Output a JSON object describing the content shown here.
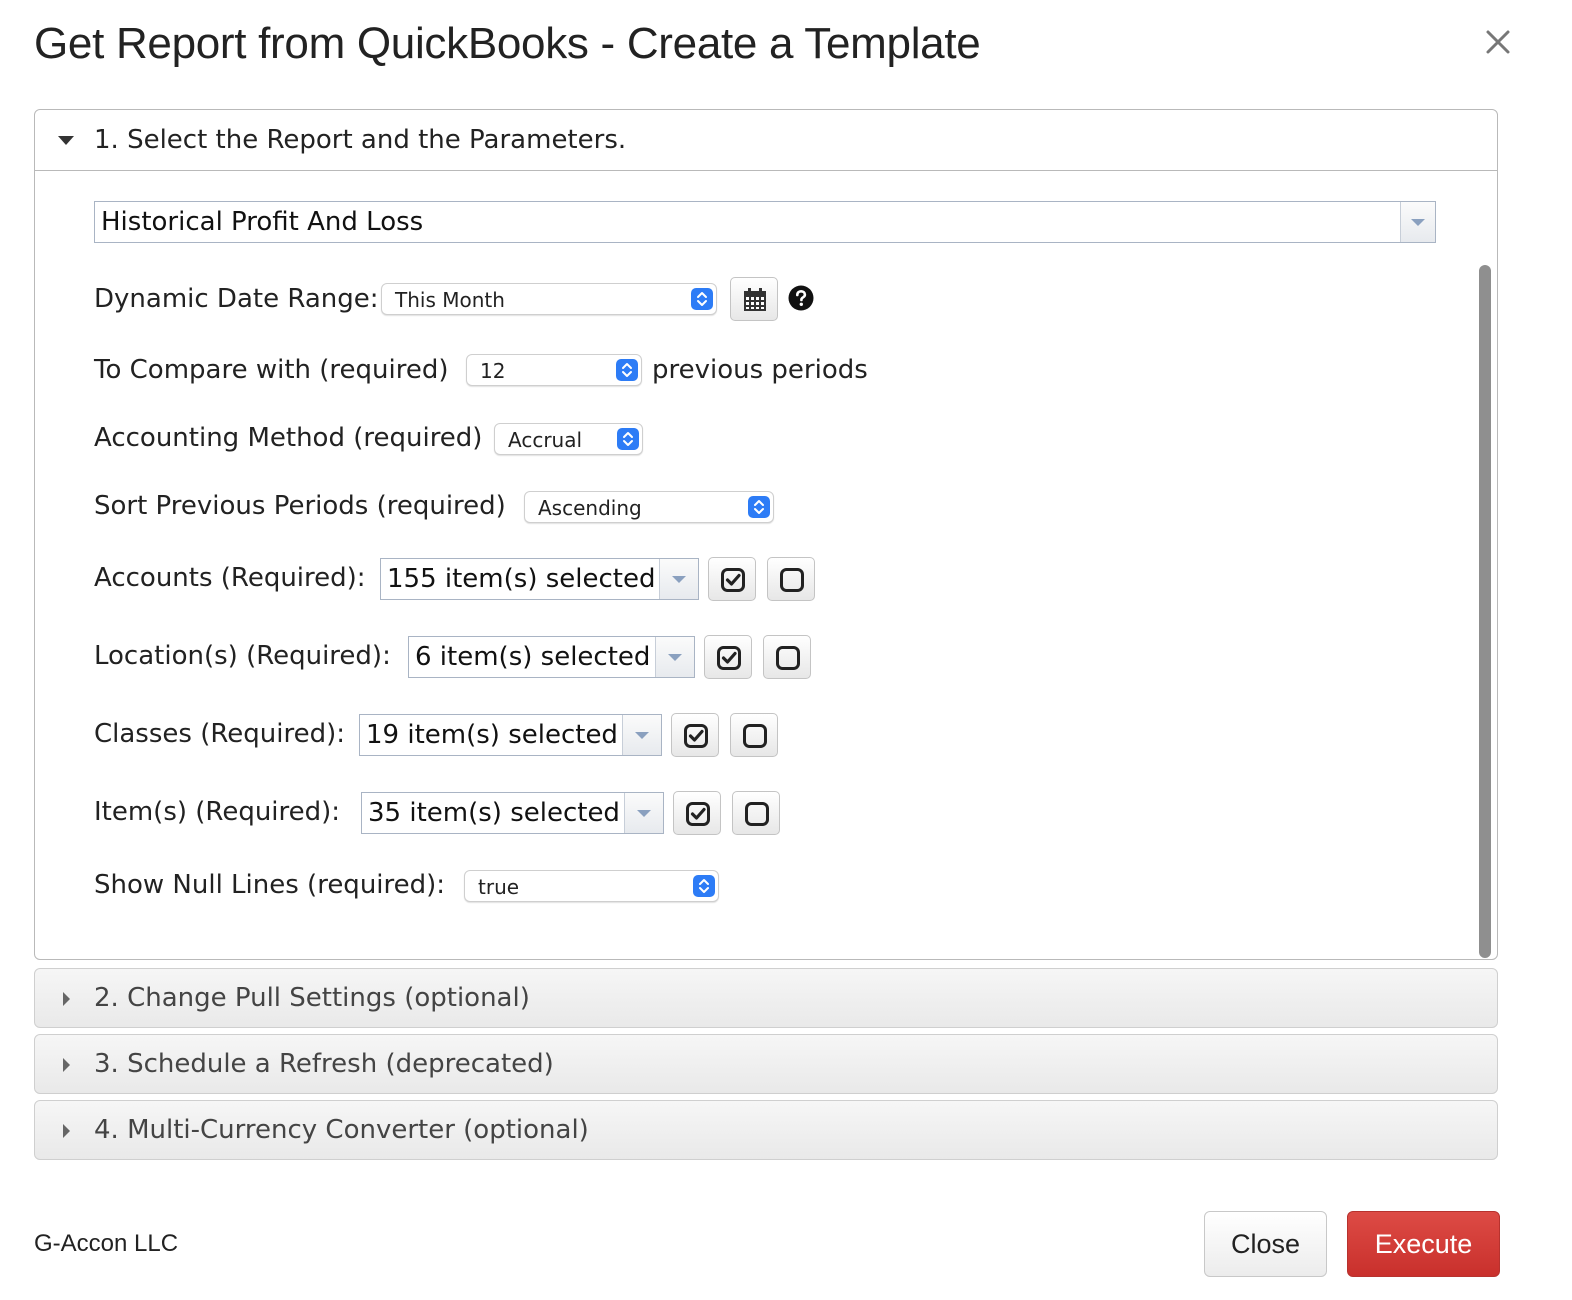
{
  "dialog": {
    "title": "Get Report from QuickBooks - Create a Template"
  },
  "sections": [
    {
      "label": "1. Select the Report and the Parameters.",
      "expanded": true
    },
    {
      "label": "2. Change Pull Settings (optional)",
      "expanded": false
    },
    {
      "label": "3. Schedule a Refresh (deprecated)",
      "expanded": false
    },
    {
      "label": "4. Multi-Currency Converter (optional)",
      "expanded": false
    }
  ],
  "report": {
    "selected": "Historical Profit And Loss"
  },
  "params": {
    "date_range": {
      "label": "Dynamic Date Range:",
      "value": "This Month"
    },
    "compare": {
      "label": "To Compare with (required)",
      "value": "12",
      "suffix": "previous periods"
    },
    "method": {
      "label": "Accounting Method (required)",
      "value": "Accrual"
    },
    "sort": {
      "label": "Sort Previous Periods (required)",
      "value": "Ascending"
    },
    "accounts": {
      "label": "Accounts (Required):",
      "value": "155 item(s) selected"
    },
    "locations": {
      "label": "Location(s) (Required):",
      "value": "6 item(s) selected"
    },
    "classes": {
      "label": "Classes (Required):",
      "value": "19 item(s) selected"
    },
    "items": {
      "label": "Item(s) (Required):",
      "value": "35 item(s) selected"
    },
    "null_lines": {
      "label": "Show Null Lines (required):",
      "value": "true"
    }
  },
  "icons": {
    "calendar": "calendar-icon",
    "help": "question-circle-icon",
    "select_all": "check-square-icon",
    "clear": "empty-square-icon",
    "close": "close-icon"
  },
  "footer": {
    "brand": "G-Accon LLC",
    "close_label": "Close",
    "execute_label": "Execute"
  },
  "colors": {
    "execute": "#d43f3a",
    "select_knob": "#2d7cf6"
  }
}
